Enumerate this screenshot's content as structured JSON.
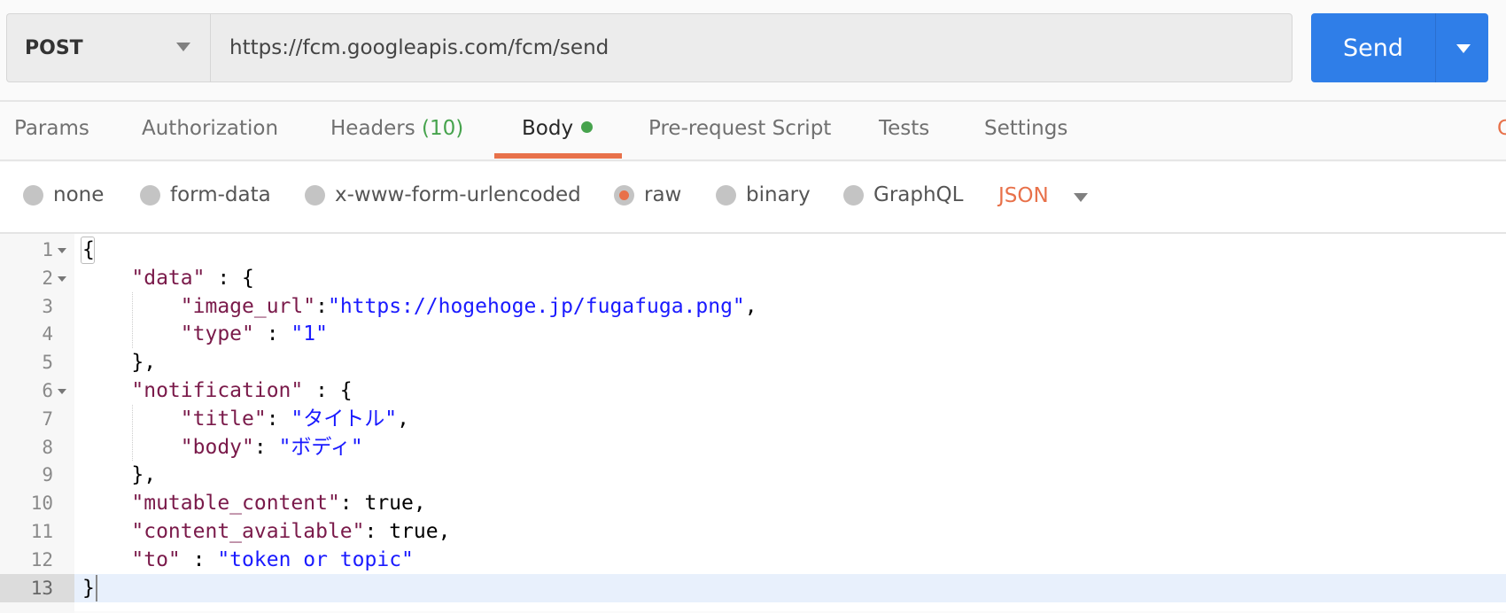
{
  "request": {
    "method": "POST",
    "url": "https://fcm.googleapis.com/fcm/send",
    "send_label": "Send"
  },
  "tabs": [
    {
      "label": "Params"
    },
    {
      "label": "Authorization"
    },
    {
      "label": "Headers",
      "count": "(10)"
    },
    {
      "label": "Body",
      "active": true
    },
    {
      "label": "Pre-request Script"
    },
    {
      "label": "Tests"
    },
    {
      "label": "Settings"
    }
  ],
  "tabs_right_partial": "C",
  "body_modes": [
    {
      "label": "none",
      "selected": false
    },
    {
      "label": "form-data",
      "selected": false
    },
    {
      "label": "x-www-form-urlencoded",
      "selected": false
    },
    {
      "label": "raw",
      "selected": true
    },
    {
      "label": "binary",
      "selected": false
    },
    {
      "label": "GraphQL",
      "selected": false
    }
  ],
  "raw_type": "JSON",
  "colors": {
    "accent": "#e8714a",
    "send": "#2f7ee8",
    "json_key": "#7a1a4a",
    "json_string": "#1a1aff",
    "headers_count": "#46a34d"
  },
  "editor": {
    "active_line": 13,
    "lines": [
      [
        {
          "t": "p",
          "v": "{"
        }
      ],
      [
        {
          "t": "p",
          "v": "    "
        },
        {
          "t": "k",
          "v": "\"data\""
        },
        {
          "t": "p",
          "v": " : {"
        }
      ],
      [
        {
          "t": "p",
          "v": "        "
        },
        {
          "t": "k",
          "v": "\"image_url\""
        },
        {
          "t": "p",
          "v": ":"
        },
        {
          "t": "s",
          "v": "\"https://hogehoge.jp/fugafuga.png\""
        },
        {
          "t": "p",
          "v": ","
        }
      ],
      [
        {
          "t": "p",
          "v": "        "
        },
        {
          "t": "k",
          "v": "\"type\""
        },
        {
          "t": "p",
          "v": " : "
        },
        {
          "t": "s",
          "v": "\"1\""
        }
      ],
      [
        {
          "t": "p",
          "v": "    },"
        }
      ],
      [
        {
          "t": "p",
          "v": "    "
        },
        {
          "t": "k",
          "v": "\"notification\""
        },
        {
          "t": "p",
          "v": " : {"
        }
      ],
      [
        {
          "t": "p",
          "v": "        "
        },
        {
          "t": "k",
          "v": "\"title\""
        },
        {
          "t": "p",
          "v": ": "
        },
        {
          "t": "s",
          "v": "\"タイトル\""
        },
        {
          "t": "p",
          "v": ","
        }
      ],
      [
        {
          "t": "p",
          "v": "        "
        },
        {
          "t": "k",
          "v": "\"body\""
        },
        {
          "t": "p",
          "v": ": "
        },
        {
          "t": "s",
          "v": "\"ボディ\""
        }
      ],
      [
        {
          "t": "p",
          "v": "    },"
        }
      ],
      [
        {
          "t": "p",
          "v": "    "
        },
        {
          "t": "k",
          "v": "\"mutable_content\""
        },
        {
          "t": "p",
          "v": ": true,"
        }
      ],
      [
        {
          "t": "p",
          "v": "    "
        },
        {
          "t": "k",
          "v": "\"content_available\""
        },
        {
          "t": "p",
          "v": ": true,"
        }
      ],
      [
        {
          "t": "p",
          "v": "    "
        },
        {
          "t": "k",
          "v": "\"to\""
        },
        {
          "t": "p",
          "v": " : "
        },
        {
          "t": "s",
          "v": "\"token or topic\""
        }
      ],
      [
        {
          "t": "p",
          "v": "}"
        }
      ]
    ],
    "foldable_lines": [
      1,
      2,
      6
    ]
  }
}
